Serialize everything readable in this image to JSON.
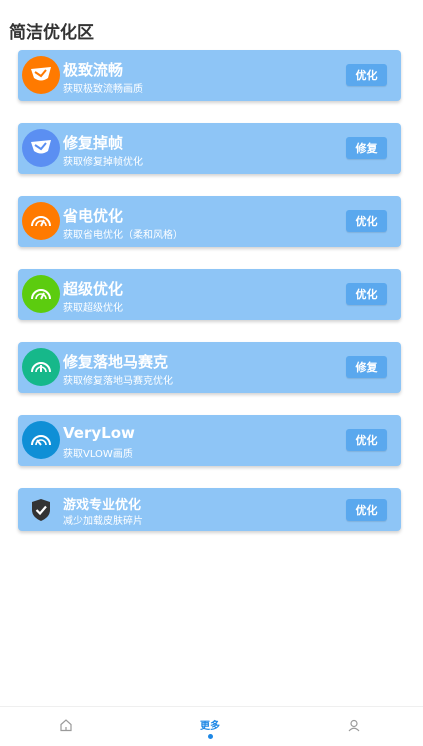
{
  "section_title": "简洁优化区",
  "items": [
    {
      "title": "极致流畅",
      "subtitle": "获取极致流畅画质",
      "action": "优化",
      "icon": "gauge-flag-icon",
      "color": "#ff7a00"
    },
    {
      "title": "修复掉帧",
      "subtitle": "获取修复掉帧优化",
      "action": "修复",
      "icon": "gauge-flag-icon",
      "color": "#5b8ff2"
    },
    {
      "title": "省电优化",
      "subtitle": "获取省电优化（柔和风格）",
      "action": "优化",
      "icon": "speedometer-icon",
      "color": "#ff7a00"
    },
    {
      "title": "超级优化",
      "subtitle": "获取超级优化",
      "action": "优化",
      "icon": "speedometer-icon",
      "color": "#5ccc0f"
    },
    {
      "title": "修复落地马赛克",
      "subtitle": "获取修复落地马赛克优化",
      "action": "修复",
      "icon": "speedometer-icon",
      "color": "#16b88a"
    },
    {
      "title": "VeryLow",
      "subtitle": "获取VLOW画质",
      "action": "优化",
      "icon": "speedometer-icon",
      "color": "#0f8fd6"
    },
    {
      "title": "游戏专业优化",
      "subtitle": "减少加载皮肤碎片",
      "action": "优化",
      "icon": "shield-check-icon",
      "color": "#333333"
    }
  ],
  "bottom_nav": {
    "home_icon": "home-icon",
    "more_label": "更多",
    "profile_icon": "profile-icon",
    "active_color": "#1e88e5"
  }
}
